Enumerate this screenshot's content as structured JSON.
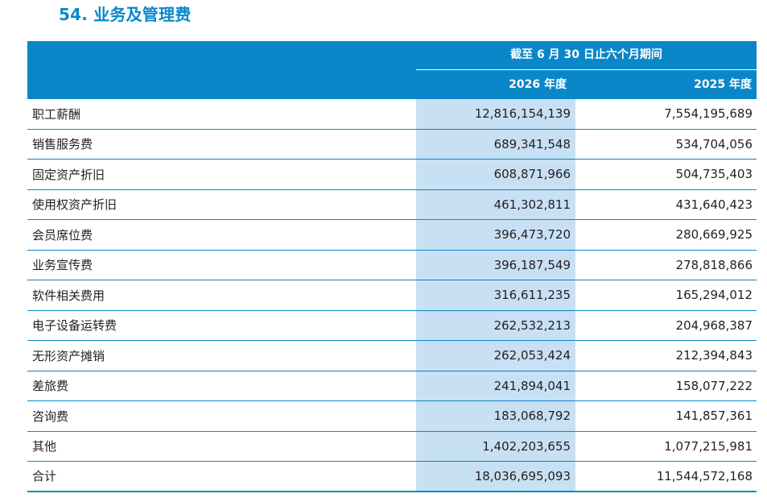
{
  "title": "54. 业务及管理费",
  "header": {
    "period": "截至 6 月 30 日止六个月期间",
    "col1": "2026 年度",
    "col2": "2025 年度"
  },
  "rows": [
    {
      "label": "职工薪酬",
      "v2026": "12,816,154,139",
      "v2025": "7,554,195,689"
    },
    {
      "label": "销售服务费",
      "v2026": "689,341,548",
      "v2025": "534,704,056"
    },
    {
      "label": "固定资产折旧",
      "v2026": "608,871,966",
      "v2025": "504,735,403"
    },
    {
      "label": "使用权资产折旧",
      "v2026": "461,302,811",
      "v2025": "431,640,423"
    },
    {
      "label": "会员席位费",
      "v2026": "396,473,720",
      "v2025": "280,669,925"
    },
    {
      "label": "业务宣传费",
      "v2026": "396,187,549",
      "v2025": "278,818,866"
    },
    {
      "label": "软件相关费用",
      "v2026": "316,611,235",
      "v2025": "165,294,012"
    },
    {
      "label": "电子设备运转费",
      "v2026": "262,532,213",
      "v2025": "204,968,387"
    },
    {
      "label": "无形资产摊销",
      "v2026": "262,053,424",
      "v2025": "212,394,843"
    },
    {
      "label": "差旅费",
      "v2026": "241,894,041",
      "v2025": "158,077,222"
    },
    {
      "label": "咨询费",
      "v2026": "183,068,792",
      "v2025": "141,857,361"
    },
    {
      "label": "其他",
      "v2026": "1,402,203,655",
      "v2025": "1,077,215,981"
    },
    {
      "label": "合计",
      "v2026": "18,036,695,093",
      "v2025": "11,544,572,168"
    }
  ]
}
